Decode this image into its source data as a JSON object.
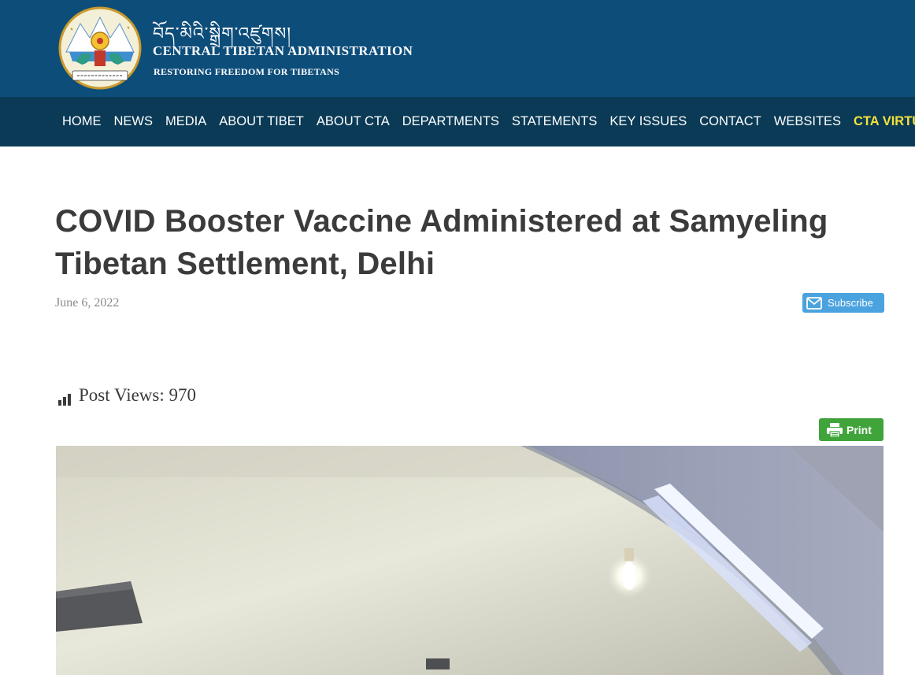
{
  "header": {
    "logo_icon": "cta-emblem-icon",
    "tibetan_name": "བོད་མིའི་སྒྲིག་འཛུགས།",
    "org_name": "CENTRAL TIBETAN ADMINISTRATION",
    "tagline": "RESTORING FREEDOM FOR TIBETANS",
    "background_color": "#0d4d7a"
  },
  "nav": {
    "background_color": "#0a3a56",
    "highlight_color": "#f4e23a",
    "items": [
      {
        "label": "HOME"
      },
      {
        "label": "NEWS"
      },
      {
        "label": "MEDIA"
      },
      {
        "label": "ABOUT TIBET"
      },
      {
        "label": "ABOUT CTA"
      },
      {
        "label": "DEPARTMENTS"
      },
      {
        "label": "STATEMENTS"
      },
      {
        "label": "KEY ISSUES"
      },
      {
        "label": "CONTACT"
      },
      {
        "label": "WEBSITES"
      },
      {
        "label": "CTA VIRTU"
      }
    ]
  },
  "article": {
    "title": "COVID Booster Vaccine Administered at Samyeling Tibetan Settlement, Delhi",
    "date": "June 6, 2022",
    "subscribe": {
      "label": "Subscribe",
      "icon": "mail-icon",
      "color": "#4aa3df"
    },
    "post_views": {
      "label": "Post Views: 970",
      "icon": "bar-chart-icon"
    },
    "print": {
      "label": "Print",
      "icon": "printer-icon",
      "color": "#3fa43a"
    },
    "featured_image": {
      "icon": "ceiling-photo"
    }
  }
}
